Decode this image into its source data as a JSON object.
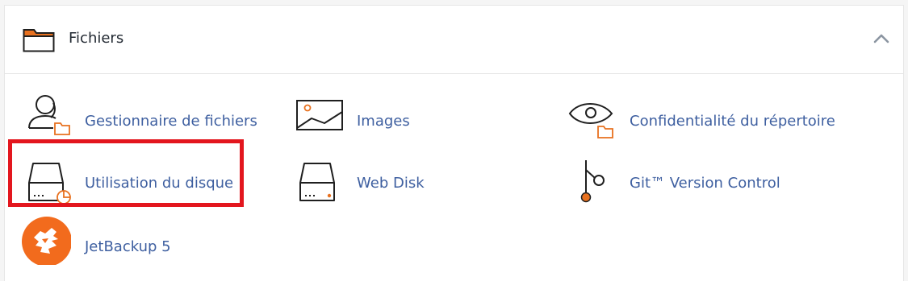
{
  "section": {
    "title": "Fichiers",
    "icon": "folder-icon",
    "collapse_icon": "chevron-up-icon"
  },
  "items": [
    {
      "label": "Gestionnaire de fichiers",
      "icon": "file-manager-icon"
    },
    {
      "label": "Images",
      "icon": "images-icon"
    },
    {
      "label": "Confidentialité du répertoire",
      "icon": "directory-privacy-icon"
    },
    {
      "label": "Utilisation du disque",
      "icon": "disk-usage-icon"
    },
    {
      "label": "Web Disk",
      "icon": "web-disk-icon"
    },
    {
      "label": "Git™ Version Control",
      "icon": "git-version-control-icon"
    },
    {
      "label": "JetBackup 5",
      "icon": "jetbackup-icon"
    }
  ],
  "colors": {
    "link": "#3e5fa0",
    "accent": "#e8711f",
    "highlight": "#e3161e",
    "icon_stroke": "#1f1f1f"
  }
}
